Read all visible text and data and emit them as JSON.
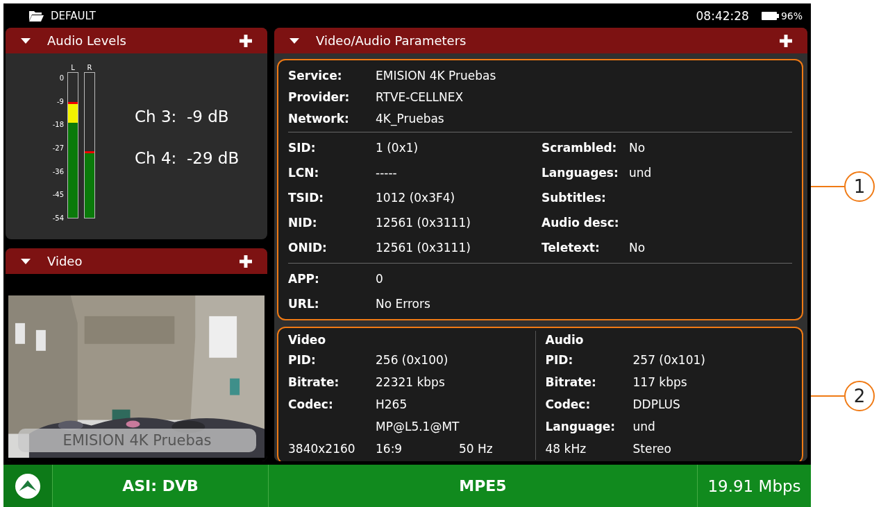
{
  "top_bar": {
    "profile": "DEFAULT",
    "time": "08:42:28",
    "battery": "96%"
  },
  "audio_panel": {
    "title": "Audio Levels",
    "expanded": true,
    "scale": [
      "0",
      "-9",
      "-18",
      "-27",
      "-36",
      "-45",
      "-54"
    ],
    "meters": [
      {
        "label": "L",
        "level": 0.8
      },
      {
        "label": "R",
        "level": 0.46
      }
    ],
    "readings": [
      "Ch 3:  -9 dB",
      "Ch 4:  -29 dB"
    ]
  },
  "video_panel": {
    "title": "Video",
    "expanded": true,
    "caption": "EMISION 4K Pruebas"
  },
  "params_panel": {
    "title": "Video/Audio Parameters",
    "expanded": true,
    "identity": [
      {
        "label": "Service:",
        "value": "EMISION 4K Pruebas"
      },
      {
        "label": "Provider:",
        "value": "RTVE-CELLNEX"
      },
      {
        "label": "Network:",
        "value": "4K_Pruebas"
      }
    ],
    "details": [
      {
        "label": "SID:",
        "value": "1 (0x1)",
        "label_2": "Scrambled:",
        "value_2": "No"
      },
      {
        "label": "LCN:",
        "value": "-----",
        "label_2": "Languages:",
        "value_2": "und"
      },
      {
        "label": "TSID:",
        "value": "1012 (0x3F4)",
        "label_2": "Subtitles:"
      },
      {
        "label": "NID:",
        "value": "12561 (0x3111)",
        "label_2": "Audio desc:"
      },
      {
        "label": "ONID:",
        "value": "12561 (0x3111)",
        "label_2": "Teletext:",
        "value_2": "No"
      }
    ],
    "app": [
      {
        "label": "APP:",
        "value": "0"
      },
      {
        "label": "URL:",
        "value": "No Errors"
      }
    ],
    "streams": [
      {
        "heading": "Video",
        "rows": [
          {
            "label": "PID:",
            "value": "256 (0x100)"
          },
          {
            "label": "Bitrate:",
            "value": "22321 kbps"
          },
          {
            "label": "Codec:",
            "value": "H265"
          },
          {
            "value": "MP@L5.1@MT"
          },
          {
            "label": "3840x2160",
            "value": "16:9",
            "extra": "50 Hz"
          }
        ]
      },
      {
        "heading": "Audio",
        "rows": [
          {
            "label": "PID:",
            "value": "257 (0x101)"
          },
          {
            "label": "Bitrate:",
            "value": "117 kbps"
          },
          {
            "label": "Codec:",
            "value": "DDPLUS"
          },
          {
            "label": "Language:",
            "value": "und"
          },
          {
            "label": "48 kHz",
            "value": "Stereo"
          }
        ]
      }
    ]
  },
  "status_bar": {
    "input": "ASI: DVB",
    "mode": "MPE5",
    "bitrate": "19.91 Mbps"
  },
  "callouts": [
    "1",
    "2"
  ]
}
